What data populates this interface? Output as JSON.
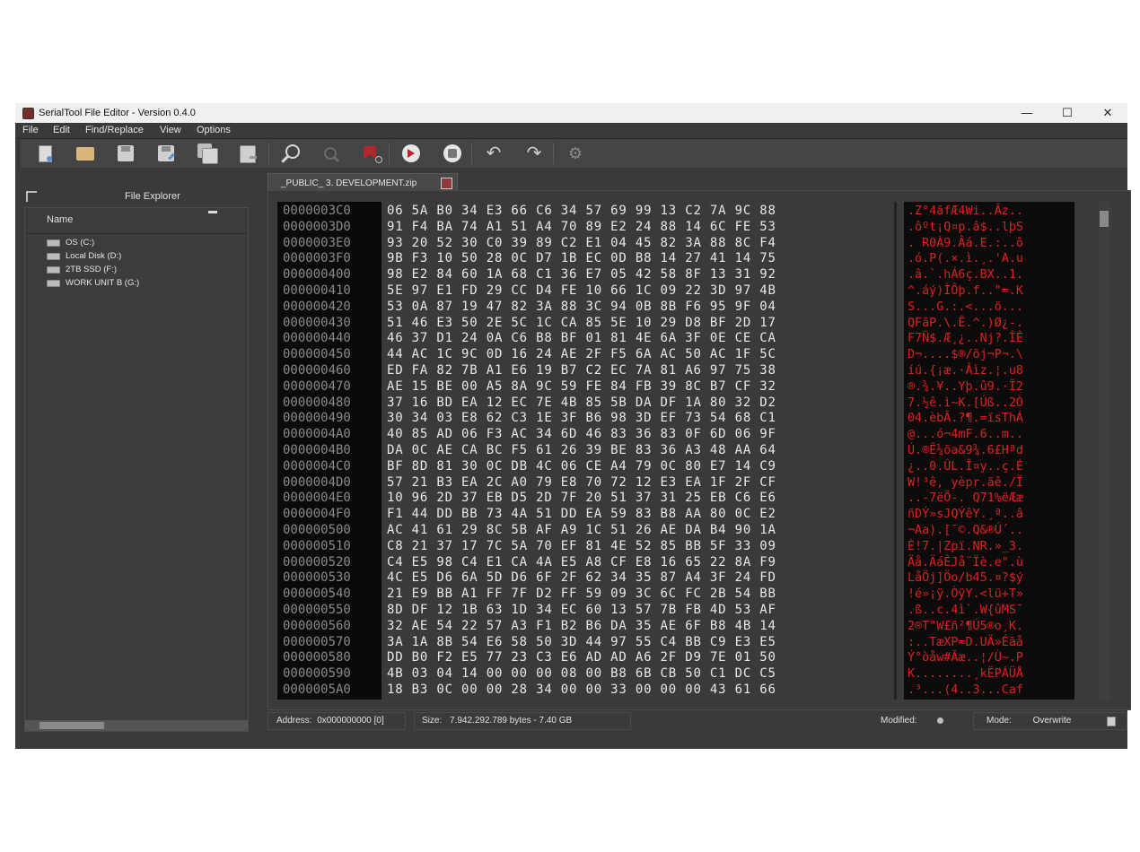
{
  "window": {
    "title": "SerialTool File Editor - Version 0.4.0",
    "controls": [
      "—",
      "☐",
      "✕"
    ]
  },
  "menu": [
    "File",
    "Edit",
    "Find/Replace",
    "View",
    "Options"
  ],
  "explorer": {
    "title": "File Explorer",
    "column": "Name",
    "drives": [
      "OS (C:)",
      "Local Disk (D:)",
      "2TB SSD (F:)",
      "WORK UNIT B (G:)"
    ]
  },
  "tab": {
    "label": "_PUBLIC_ 3. DEVELOPMENT.zip"
  },
  "hex": {
    "rows": [
      {
        "addr": "0000003C0",
        "bytes": "06 5A B0 34 E3 66 C6 34 57 69 99 13 C2 7A 9C 88",
        "ascii": ".Z°4ãfÆ4Wi..Âz.."
      },
      {
        "addr": "0000003D0",
        "bytes": "91 F4 BA 74 A1 51 A4 70 89 E2 24 88 14 6C FE 53",
        "ascii": ".ôºt¡Q¤p.â$..lþS"
      },
      {
        "addr": "0000003E0",
        "bytes": "93 20 52 30 C0 39 89 C2 E1 04 45 82 3A 88 8C F4",
        "ascii": ". R0À9.Âá.E.:..ô"
      },
      {
        "addr": "0000003F0",
        "bytes": "9B F3 10 50 28 0C D7 1B EC 0D B8 14 27 41 14 75",
        "ascii": ".ó.P(.×.ì.¸.'A.u"
      },
      {
        "addr": "000000400",
        "bytes": "98 E2 84 60 1A 68 C1 36 E7 05 42 58 8F 13 31 92",
        "ascii": ".â.`.hÁ6ç.BX..1."
      },
      {
        "addr": "000000410",
        "bytes": "5E 97 E1 FD 29 CC D4 FE 10 66 1C 09 22 3D 97 4B",
        "ascii": "^.áý)ÌÔþ.f..\"=.K"
      },
      {
        "addr": "000000420",
        "bytes": "53 0A 87 19 47 82 3A 88 3C 94 0B 8B F6 95 9F 04",
        "ascii": "S...G.:.<...ö..."
      },
      {
        "addr": "000000430",
        "bytes": "51 46 E3 50 2E 5C 1C CA 85 5E 10 29 D8 BF 2D 17",
        "ascii": "QFãP.\\.Ê.^.)Ø¿-."
      },
      {
        "addr": "000000440",
        "bytes": "46 37 D1 24 0A C6 B8 BF 01 81 4E 6A 3F 0E CE CA",
        "ascii": "F7Ñ$.Æ¸¿..Nj?.ÎÊ"
      },
      {
        "addr": "000000450",
        "bytes": "44 AC 1C 9C 0D 16 24 AE 2F F5 6A AC 50 AC 1F 5C",
        "ascii": "D¬....$®/õj¬P¬.\\"
      },
      {
        "addr": "000000460",
        "bytes": "ED FA 82 7B A1 E6 19 B7 C2 EC 7A 81 A6 97 75 38",
        "ascii": "íú.{¡æ.·Âìz.¦.u8"
      },
      {
        "addr": "000000470",
        "bytes": "AE 15 BE 00 A5 8A 9C 59 FE 84 FB 39 8C B7 CF 32",
        "ascii": "®.¾.¥..Yþ.û9.·Ï2"
      },
      {
        "addr": "000000480",
        "bytes": "37 16 BD EA 12 EC 7E 4B 85 5B DA DF 1A 80 32 D2",
        "ascii": "7.½ê.ì~K.[Úß..2Ò"
      },
      {
        "addr": "000000490",
        "bytes": "30 34 03 E8 62 C3 1E 3F B6 98 3D EF 73 54 68 C1",
        "ascii": "04.èbÃ.?¶.=ïsThÁ"
      },
      {
        "addr": "0000004A0",
        "bytes": "40 85 AD 06 F3 AC 34 6D 46 83 36 83 0F 6D 06 9F",
        "ascii": "@...ó¬4mF.6..m.."
      },
      {
        "addr": "0000004B0",
        "bytes": "DA 0C AE CA BC F5 61 26 39 BE 83 36 A3 48 AA 64",
        "ascii": "Ú.®Ê¼õa&9¾.6£Hªd"
      },
      {
        "addr": "0000004C0",
        "bytes": "BF 8D 81 30 0C DB 4C 06 CE A4 79 0C 80 E7 14 C9",
        "ascii": "¿..0.ÛL.Î¤y..ç.É"
      },
      {
        "addr": "0000004D0",
        "bytes": "57 21 B3 EA 2C A0 79 E8 70 72 12 E3 EA 1F 2F CF",
        "ascii": "W!³ê, yèpr.ãê./Ï"
      },
      {
        "addr": "0000004E0",
        "bytes": "10 96 2D 37 EB D5 2D 7F 20 51 37 31 25 EB C6 E6",
        "ascii": "..-7ëÕ-. Q71%ëÆæ"
      },
      {
        "addr": "0000004F0",
        "bytes": "F1 44 DD BB 73 4A 51 DD EA 59 83 B8 AA 80 0C E2",
        "ascii": "ñDÝ»sJQÝêY.¸ª..â"
      },
      {
        "addr": "000000500",
        "bytes": "AC 41 61 29 8C 5B AF A9 1C 51 26 AE DA B4 90 1A",
        "ascii": "¬Aa).[¯©.Q&®Ú´.."
      },
      {
        "addr": "000000510",
        "bytes": "C8 21 37 17 7C 5A 70 EF 81 4E 52 85 BB 5F 33 09",
        "ascii": "È!7.|Zpï.NR.»_3."
      },
      {
        "addr": "000000520",
        "bytes": "C4 E5 98 C4 E1 CA 4A E5 A8 CF E8 16 65 22 8A F9",
        "ascii": "Äå.ÄáÊJå¨Ïè.e\".ù"
      },
      {
        "addr": "000000530",
        "bytes": "4C E5 D6 6A 5D D6 6F 2F 62 34 35 87 A4 3F 24 FD",
        "ascii": "LåÖj]Öo/b45.¤?$ý"
      },
      {
        "addr": "000000540",
        "bytes": "21 E9 BB A1 FF 7F D2 FF 59 09 3C 6C FC 2B 54 BB",
        "ascii": "!é»¡ÿ.ÒÿY.<lü+T»"
      },
      {
        "addr": "000000550",
        "bytes": "8D DF 12 1B 63 1D 34 EC 60 13 57 7B FB 4D 53 AF",
        "ascii": ".ß..c.4ì`.W{ûMS¯"
      },
      {
        "addr": "000000560",
        "bytes": "32 AE 54 22 57 A3 F1 B2 B6 DA 35 AE 6F B8 4B 14",
        "ascii": "2®T\"W£ñ²¶Ú5®o¸K."
      },
      {
        "addr": "000000570",
        "bytes": "3A 1A 8B 54 E6 58 50 3D 44 97 55 C4 BB C9 E3 E5",
        "ascii": ":..TæXP=D.UÄ»Éãå"
      },
      {
        "addr": "000000580",
        "bytes": "DD B0 F2 E5 77 23 C3 E6 AD AD A6 2F D9 7E 01 50",
        "ascii": "Ý°òåw#Ãæ..¦/Ù~.P"
      },
      {
        "addr": "000000590",
        "bytes": "4B 03 04 14 00 00 00 08 00 B8 6B CB 50 C1 DC C5",
        "ascii": "K........¸kËPÁÜÅ"
      },
      {
        "addr": "0000005A0",
        "bytes": "18 B3 0C 00 00 28 34 00 00 33 00 00 00 43 61 66",
        "ascii": ".³...(4..3...Caf"
      }
    ]
  },
  "status": {
    "address_label": "Address:",
    "address_value": "0x000000000 [0]",
    "size_label": "Size:",
    "size_value": "7.942.292.789 bytes - 7.40 GB",
    "modified_label": "Modified:",
    "mode_label": "Mode:",
    "mode_value": "Overwrite"
  }
}
